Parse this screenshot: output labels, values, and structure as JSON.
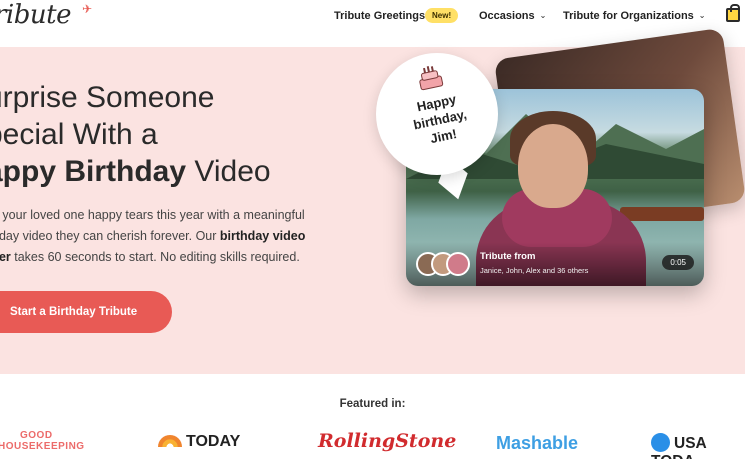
{
  "header": {
    "logo_text": "ribute",
    "nav": {
      "tribute_greetings": "Tribute Greetings",
      "new_badge": "New!",
      "occasions": "Occasions",
      "organizations": "Tribute for Organizations"
    }
  },
  "hero": {
    "headline_line1": "urprise Someone",
    "headline_line2": "pecial With a",
    "headline_line3_bold": "appy Birthday",
    "headline_line3_rest": " Video",
    "subtext_part1": "e your loved one happy tears this year with a meaningful",
    "subtext_part2": "hday video they can cherish forever. Our ",
    "subtext_bold1": "birthday video",
    "subtext_bold2": "ker",
    "subtext_part3": " takes 60 seconds to start. No editing skills required.",
    "cta_label": "Start a Birthday Tribute",
    "bubble_text_1": "Happy",
    "bubble_text_2": "birthday,",
    "bubble_text_3": "Jim!",
    "card": {
      "tribute_from": "Tribute from",
      "contributors": "Janice, John, Alex and 36 others",
      "duration": "0:05"
    }
  },
  "featured": {
    "label": "Featured in:",
    "logos": {
      "good_housekeeping_1": "GOOD",
      "good_housekeeping_2": "HOUSEKEEPING",
      "today": "TODAY",
      "rolling_stone": "RollingStone",
      "mashable": "Mashable",
      "usa_today": "USA TODA"
    }
  },
  "colors": {
    "hero_bg": "#fbe3e1",
    "cta": "#e85a55",
    "badge": "#ffe066"
  }
}
